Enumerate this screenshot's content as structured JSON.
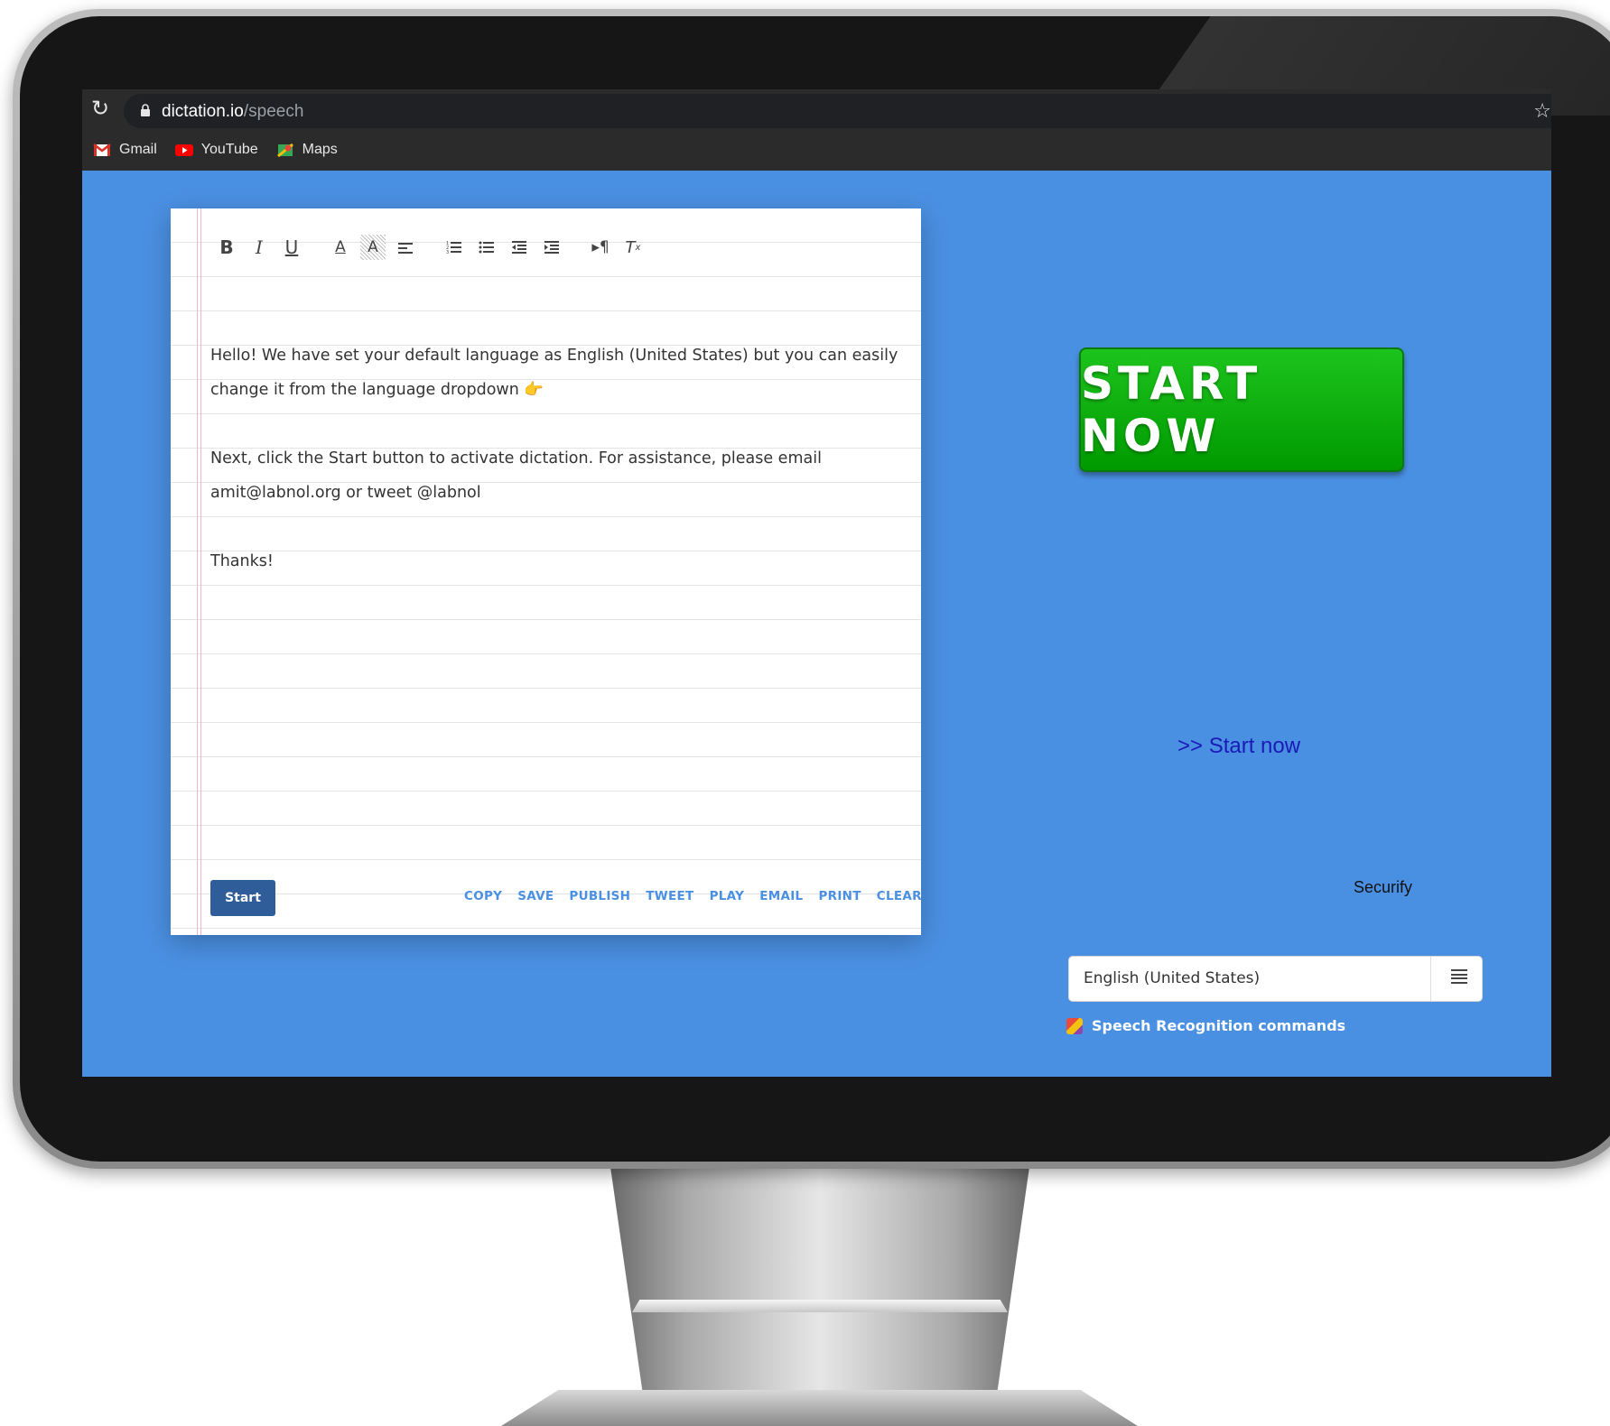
{
  "browser": {
    "url_host": "dictation.io",
    "url_path": "/speech",
    "bookmarks": [
      {
        "label": "Gmail",
        "icon": "gmail-icon"
      },
      {
        "label": "YouTube",
        "icon": "youtube-icon"
      },
      {
        "label": "Maps",
        "icon": "maps-icon"
      }
    ]
  },
  "editor": {
    "toolbar": [
      "bold",
      "italic",
      "underline",
      "font-color",
      "highlight",
      "align",
      "ordered-list",
      "bullet-list",
      "outdent",
      "indent",
      "text-direction",
      "clear-formatting"
    ],
    "paragraphs": [
      "Hello!  We have set your default language as  English (United States) but you can easily change it from the language dropdown 👉",
      "Next, click the Start button to activate dictation.  For assistance,  please email amit@labnol.org or tweet @labnol",
      "Thanks!"
    ],
    "start_label": "Start",
    "actions": [
      "COPY",
      "SAVE",
      "PUBLISH",
      "TWEET",
      "PLAY",
      "EMAIL",
      "PRINT",
      "CLEAR"
    ]
  },
  "sidebar": {
    "start_now_button": "START NOW",
    "start_now_link": ">> Start now",
    "securify": "Securify",
    "language": "English (United States)",
    "speech_commands": "Speech Recognition commands"
  },
  "colors": {
    "page_background": "#4a90e2",
    "start_button": "#2f5d99",
    "start_now_green": "#1dc41d",
    "action_link": "#4a90e2"
  }
}
